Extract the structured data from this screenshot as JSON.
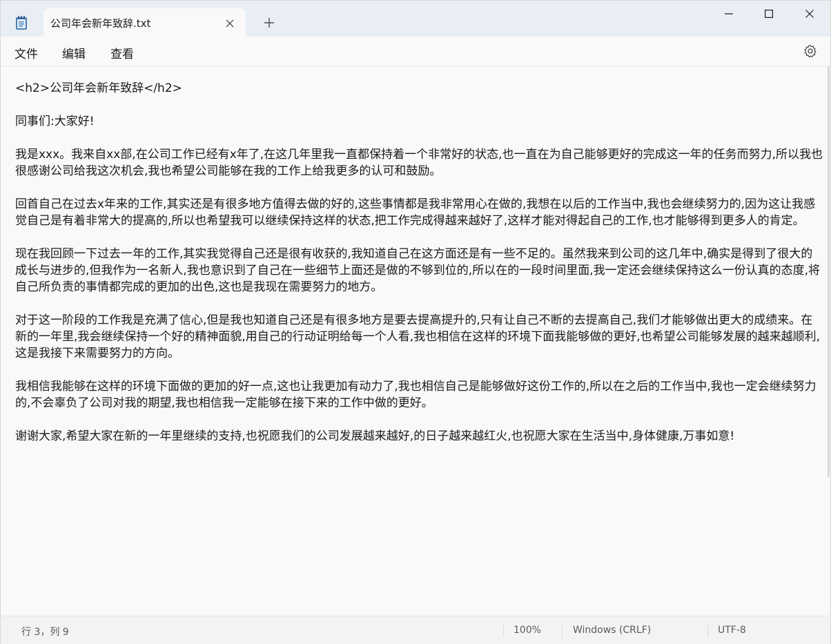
{
  "window": {
    "tab_title": "公司年会新年致辞.txt",
    "icons": {
      "app": "notepad-icon",
      "tab_close": "close-icon",
      "new_tab": "plus-icon",
      "minimize": "minimize-icon",
      "maximize": "maximize-icon",
      "close": "close-icon",
      "settings": "gear-icon"
    }
  },
  "menu": {
    "file": "文件",
    "edit": "编辑",
    "view": "查看"
  },
  "editor": {
    "lines": [
      "<h2>公司年会新年致辞</h2>",
      "同事们:大家好!",
      "我是xxx。我来自xx部,在公司工作已经有x年了,在这几年里我一直都保持着一个非常好的状态,也一直在为自己能够更好的完成这一年的任务而努力,所以我也很感谢公司给我这次机会,我也希望公司能够在我的工作上给我更多的认可和鼓励。",
      "回首自己在过去x年来的工作,其实还是有很多地方值得去做的好的,这些事情都是我非常用心在做的,我想在以后的工作当中,我也会继续努力的,因为这让我感觉自己是有着非常大的提高的,所以也希望我可以继续保持这样的状态,把工作完成得越来越好了,这样才能对得起自己的工作,也才能够得到更多人的肯定。",
      "现在我回顾一下过去一年的工作,其实我觉得自己还是很有收获的,我知道自己在这方面还是有一些不足的。虽然我来到公司的这几年中,确实是得到了很大的成长与进步的,但我作为一名新人,我也意识到了自己在一些细节上面还是做的不够到位的,所以在的一段时间里面,我一定还会继续保持这么一份认真的态度,将自己所负责的事情都完成的更加的出色,这也是我现在需要努力的地方。",
      "对于这一阶段的工作我是充满了信心,但是我也知道自己还是有很多地方是要去提高提升的,只有让自己不断的去提高自己,我们才能够做出更大的成绩来。在新的一年里,我会继续保持一个好的精神面貌,用自己的行动证明给每一个人看,我也相信在这样的环境下面我能够做的更好,也希望公司能够发展的越来越顺利,这是我接下来需要努力的方向。",
      "我相信我能够在这样的环境下面做的更加的好一点,这也让我更加有动力了,我也相信自己是能够做好这份工作的,所以在之后的工作当中,我也一定会继续努力的,不会辜负了公司对我的期望,我也相信我一定能够在接下来的工作中做的更好。",
      "谢谢大家,希望大家在新的一年里继续的支持,也祝愿我们的公司发展越来越好,的日子越来越红火,也祝愿大家在生活当中,身体健康,万事如意!"
    ]
  },
  "status": {
    "position": "行 3，列 9",
    "zoom": "100%",
    "line_ending": "Windows (CRLF)",
    "encoding": "UTF-8"
  }
}
